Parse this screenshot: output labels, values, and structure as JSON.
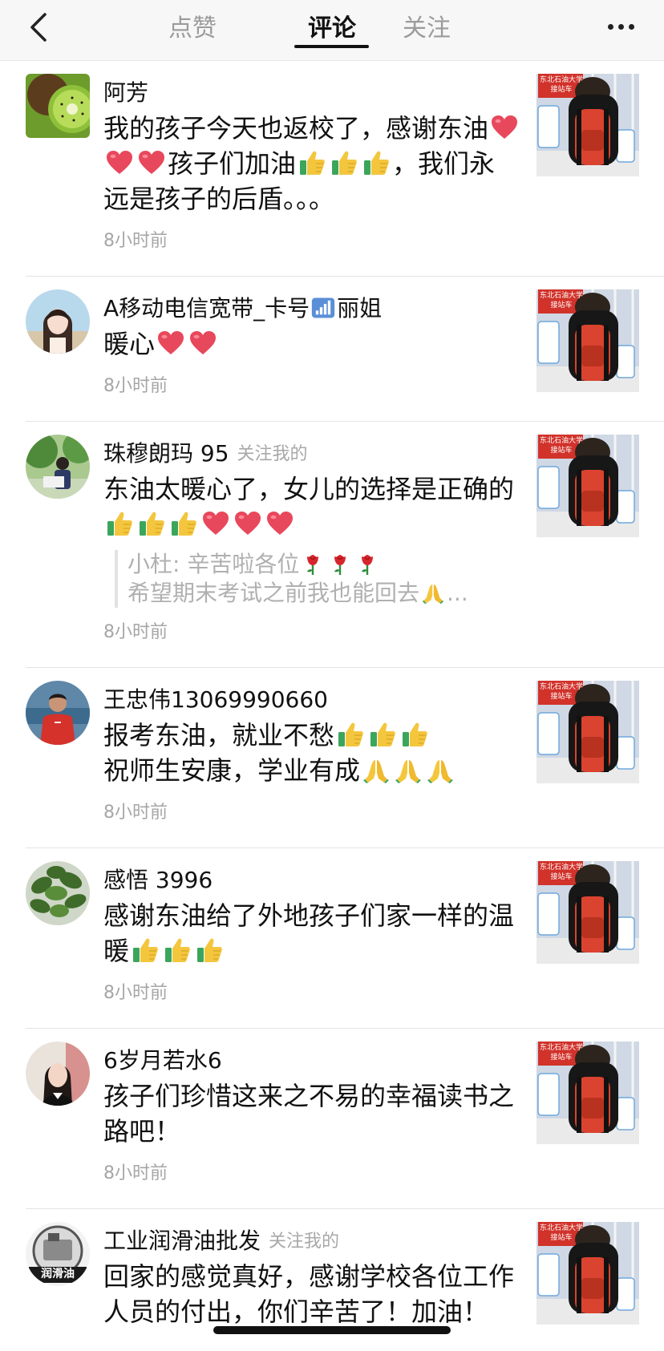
{
  "nav": {
    "tabs": [
      {
        "label": "点赞",
        "active": false
      },
      {
        "label": "评论",
        "active": true
      },
      {
        "label": "关注",
        "active": false
      }
    ],
    "back_icon": "chevron-left-icon",
    "more_icon": "more-dots-icon"
  },
  "comments": [
    {
      "name": "阿芳",
      "follow_tag": "",
      "segments": [
        {
          "t": "我的孩子今天也返校了，感谢东油"
        },
        {
          "e": "heart"
        },
        {
          "e": "heart"
        },
        {
          "e": "heart"
        },
        {
          "t": "孩子们加油"
        },
        {
          "e": "thumbsup"
        },
        {
          "e": "thumbsup"
        },
        {
          "e": "thumbsup"
        },
        {
          "t": "，我们永远是孩子的后盾。。。"
        }
      ],
      "reply": [],
      "time": "8小时前",
      "avatar": "kiwi"
    },
    {
      "name": "A移动电信宽带_卡号",
      "name_icon": "signal",
      "name_suffix": "丽姐",
      "follow_tag": "",
      "segments": [
        {
          "t": "暖心"
        },
        {
          "e": "heart"
        },
        {
          "e": "heart"
        }
      ],
      "reply": [],
      "time": "8小时前",
      "avatar": "girl"
    },
    {
      "name": "珠穆朗玛 95",
      "follow_tag": "关注我的",
      "segments": [
        {
          "t": "东油太暖心了，女儿的选择是正确的"
        },
        {
          "e": "thumbsup"
        },
        {
          "e": "thumbsup"
        },
        {
          "e": "thumbsup"
        },
        {
          "e": "heart"
        },
        {
          "e": "heart"
        },
        {
          "e": "heart"
        }
      ],
      "reply": [
        [
          {
            "t": "小杜: 辛苦啦各位"
          },
          {
            "e": "rose"
          },
          {
            "e": "rose"
          },
          {
            "e": "rose"
          }
        ],
        [
          {
            "t": "希望期末考试之前我也能回去"
          },
          {
            "e": "pray"
          },
          {
            "t": "..."
          }
        ]
      ],
      "time": "8小时前",
      "avatar": "tree-person"
    },
    {
      "name": "王忠伟13069990660",
      "follow_tag": "",
      "segments": [
        {
          "t": "报考东油，就业不愁"
        },
        {
          "e": "thumbsup"
        },
        {
          "e": "thumbsup"
        },
        {
          "e": "thumbsup"
        },
        {
          "br": true
        },
        {
          "t": "祝师生安康，学业有成"
        },
        {
          "e": "pray"
        },
        {
          "e": "pray"
        },
        {
          "e": "pray"
        }
      ],
      "reply": [],
      "time": "8小时前",
      "avatar": "man-red"
    },
    {
      "name": "感悟 3996",
      "follow_tag": "",
      "segments": [
        {
          "t": "感谢东油给了外地孩子们家一样的温暖"
        },
        {
          "e": "thumbsup"
        },
        {
          "e": "thumbsup"
        },
        {
          "e": "thumbsup"
        }
      ],
      "reply": [],
      "time": "8小时前",
      "avatar": "plant"
    },
    {
      "name": "6岁月若水6",
      "follow_tag": "",
      "segments": [
        {
          "t": "孩子们珍惜这来之不易的幸福读书之路吧！"
        }
      ],
      "reply": [],
      "time": "8小时前",
      "avatar": "woman"
    },
    {
      "name": "工业润滑油批发",
      "follow_tag": "关注我的",
      "segments": [
        {
          "t": "回家的感觉真好，感谢学校各位工作人员的付出，你们辛苦了！加油！"
        }
      ],
      "reply": [],
      "time": "",
      "avatar": "oil-logo",
      "avatar_text": "润滑油"
    }
  ],
  "thumbnail": {
    "banner_line1": "东北石油大学",
    "banner_line2": "接站车"
  },
  "colors": {
    "heart": "#e8485c",
    "thumbsup": "#f4c63d",
    "cuff": "#3ba55c",
    "backpack": "#d9432f"
  }
}
